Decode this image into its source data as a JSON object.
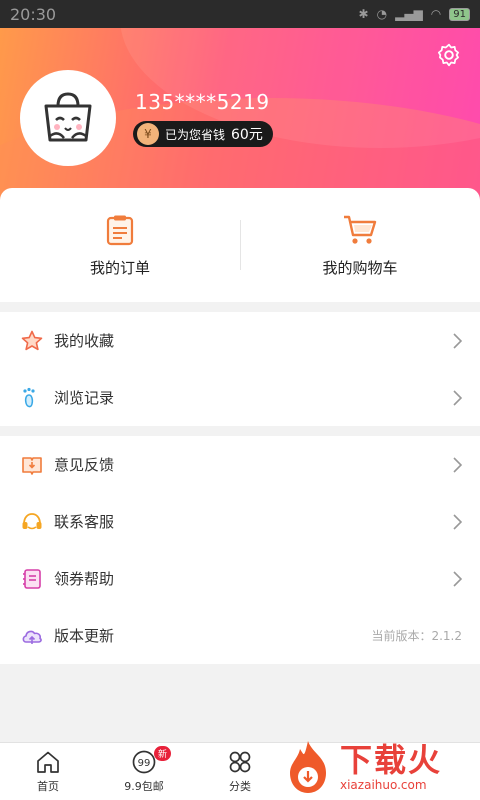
{
  "status_bar": {
    "time": "20:30",
    "battery": "91"
  },
  "profile": {
    "phone": "135****5219",
    "saved_label": "已为您省钱",
    "saved_amount": "60元"
  },
  "orders": {
    "my_orders": "我的订单",
    "my_cart": "我的购物车"
  },
  "menu_group1": [
    {
      "label": "我的收藏",
      "icon": "star-icon"
    },
    {
      "label": "浏览记录",
      "icon": "footprint-icon"
    }
  ],
  "menu_group2": [
    {
      "label": "意见反馈",
      "icon": "feedback-book-icon"
    },
    {
      "label": "联系客服",
      "icon": "headset-icon"
    },
    {
      "label": "领券帮助",
      "icon": "coupon-help-icon"
    },
    {
      "label": "版本更新",
      "icon": "cloud-update-icon",
      "value": "当前版本：2.1.2"
    }
  ],
  "bottom_nav": [
    {
      "label": "首页",
      "icon": "home-icon"
    },
    {
      "label": "9.9包邮",
      "icon": "free-shipping-icon",
      "badge": "新"
    },
    {
      "label": "分类",
      "icon": "category-grid-icon"
    }
  ],
  "watermark": {
    "brand": "下载火",
    "url": "xiazaihuo.com"
  },
  "colors": {
    "header_gradient_start": "#ff9a4a",
    "header_gradient_end": "#ff3aa8",
    "accent_orange": "#f07c3c",
    "badge_red": "#e8213a"
  }
}
